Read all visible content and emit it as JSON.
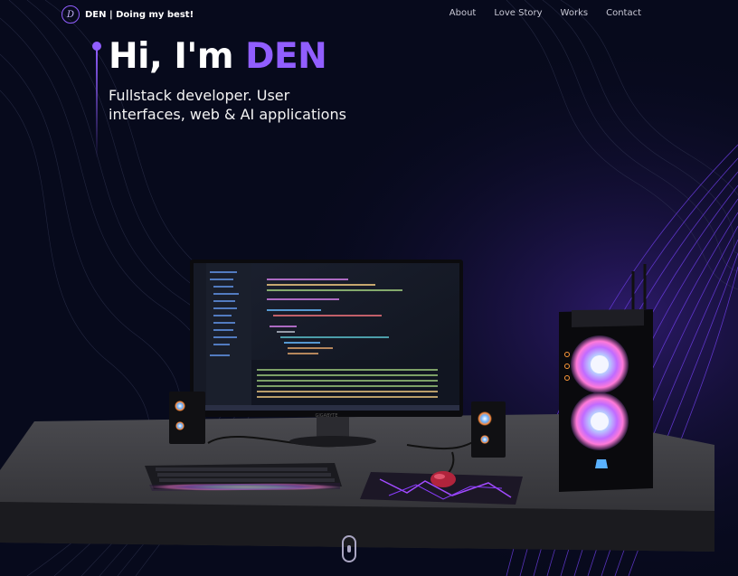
{
  "header": {
    "logo_initial": "D",
    "logo_text": "DEN | Doing my best!",
    "nav": [
      "About",
      "Love Story",
      "Works",
      "Contact"
    ]
  },
  "hero": {
    "greeting": "Hi, I'm ",
    "name": "DEN",
    "subtitle": "Fullstack developer. User interfaces, web & AI applications"
  },
  "scene": {
    "monitor_brand": "GIGABYTE"
  },
  "colors": {
    "background": "#050816",
    "accent": "#915eff",
    "text_secondary": "#aaa6c3"
  },
  "icons": [
    "scroll-mouse-icon"
  ]
}
